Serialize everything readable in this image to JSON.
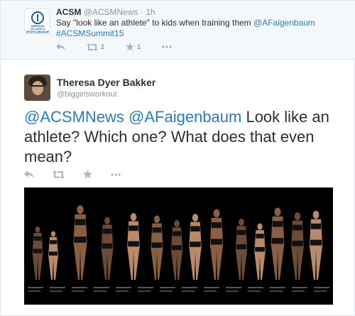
{
  "parent_tweet": {
    "author_name": "ACSM",
    "author_handle": "@ACSMNews",
    "separator": "·",
    "time": "1h",
    "text_before": "Say \"look like an athlete\" to kids when training them ",
    "mention": "@AFaigenbaum",
    "hashtag": "#ACSMSummit15",
    "avatar_text": "AMERICAN COLLEGE of SPORTS MEDICINE LEADING THE WAY",
    "retweet_count": "2",
    "favorite_count": "1"
  },
  "main_tweet": {
    "author_name": "Theresa Dyer Bakker",
    "author_handle": "@biggirlsworkout",
    "mention_1": "@ACSMNews",
    "mention_2": "@AFaigenbaum",
    "text": " Look like an athlete? Which one? What does that even mean?",
    "photo_caption": "athletes lineup photo"
  },
  "icons": {
    "reply": "reply-icon",
    "retweet": "retweet-icon",
    "favorite": "star-icon",
    "more": "more-icon"
  },
  "colors": {
    "link": "#2b7bb9",
    "muted": "#8899a6",
    "parent_bg": "#f5f8fa"
  }
}
